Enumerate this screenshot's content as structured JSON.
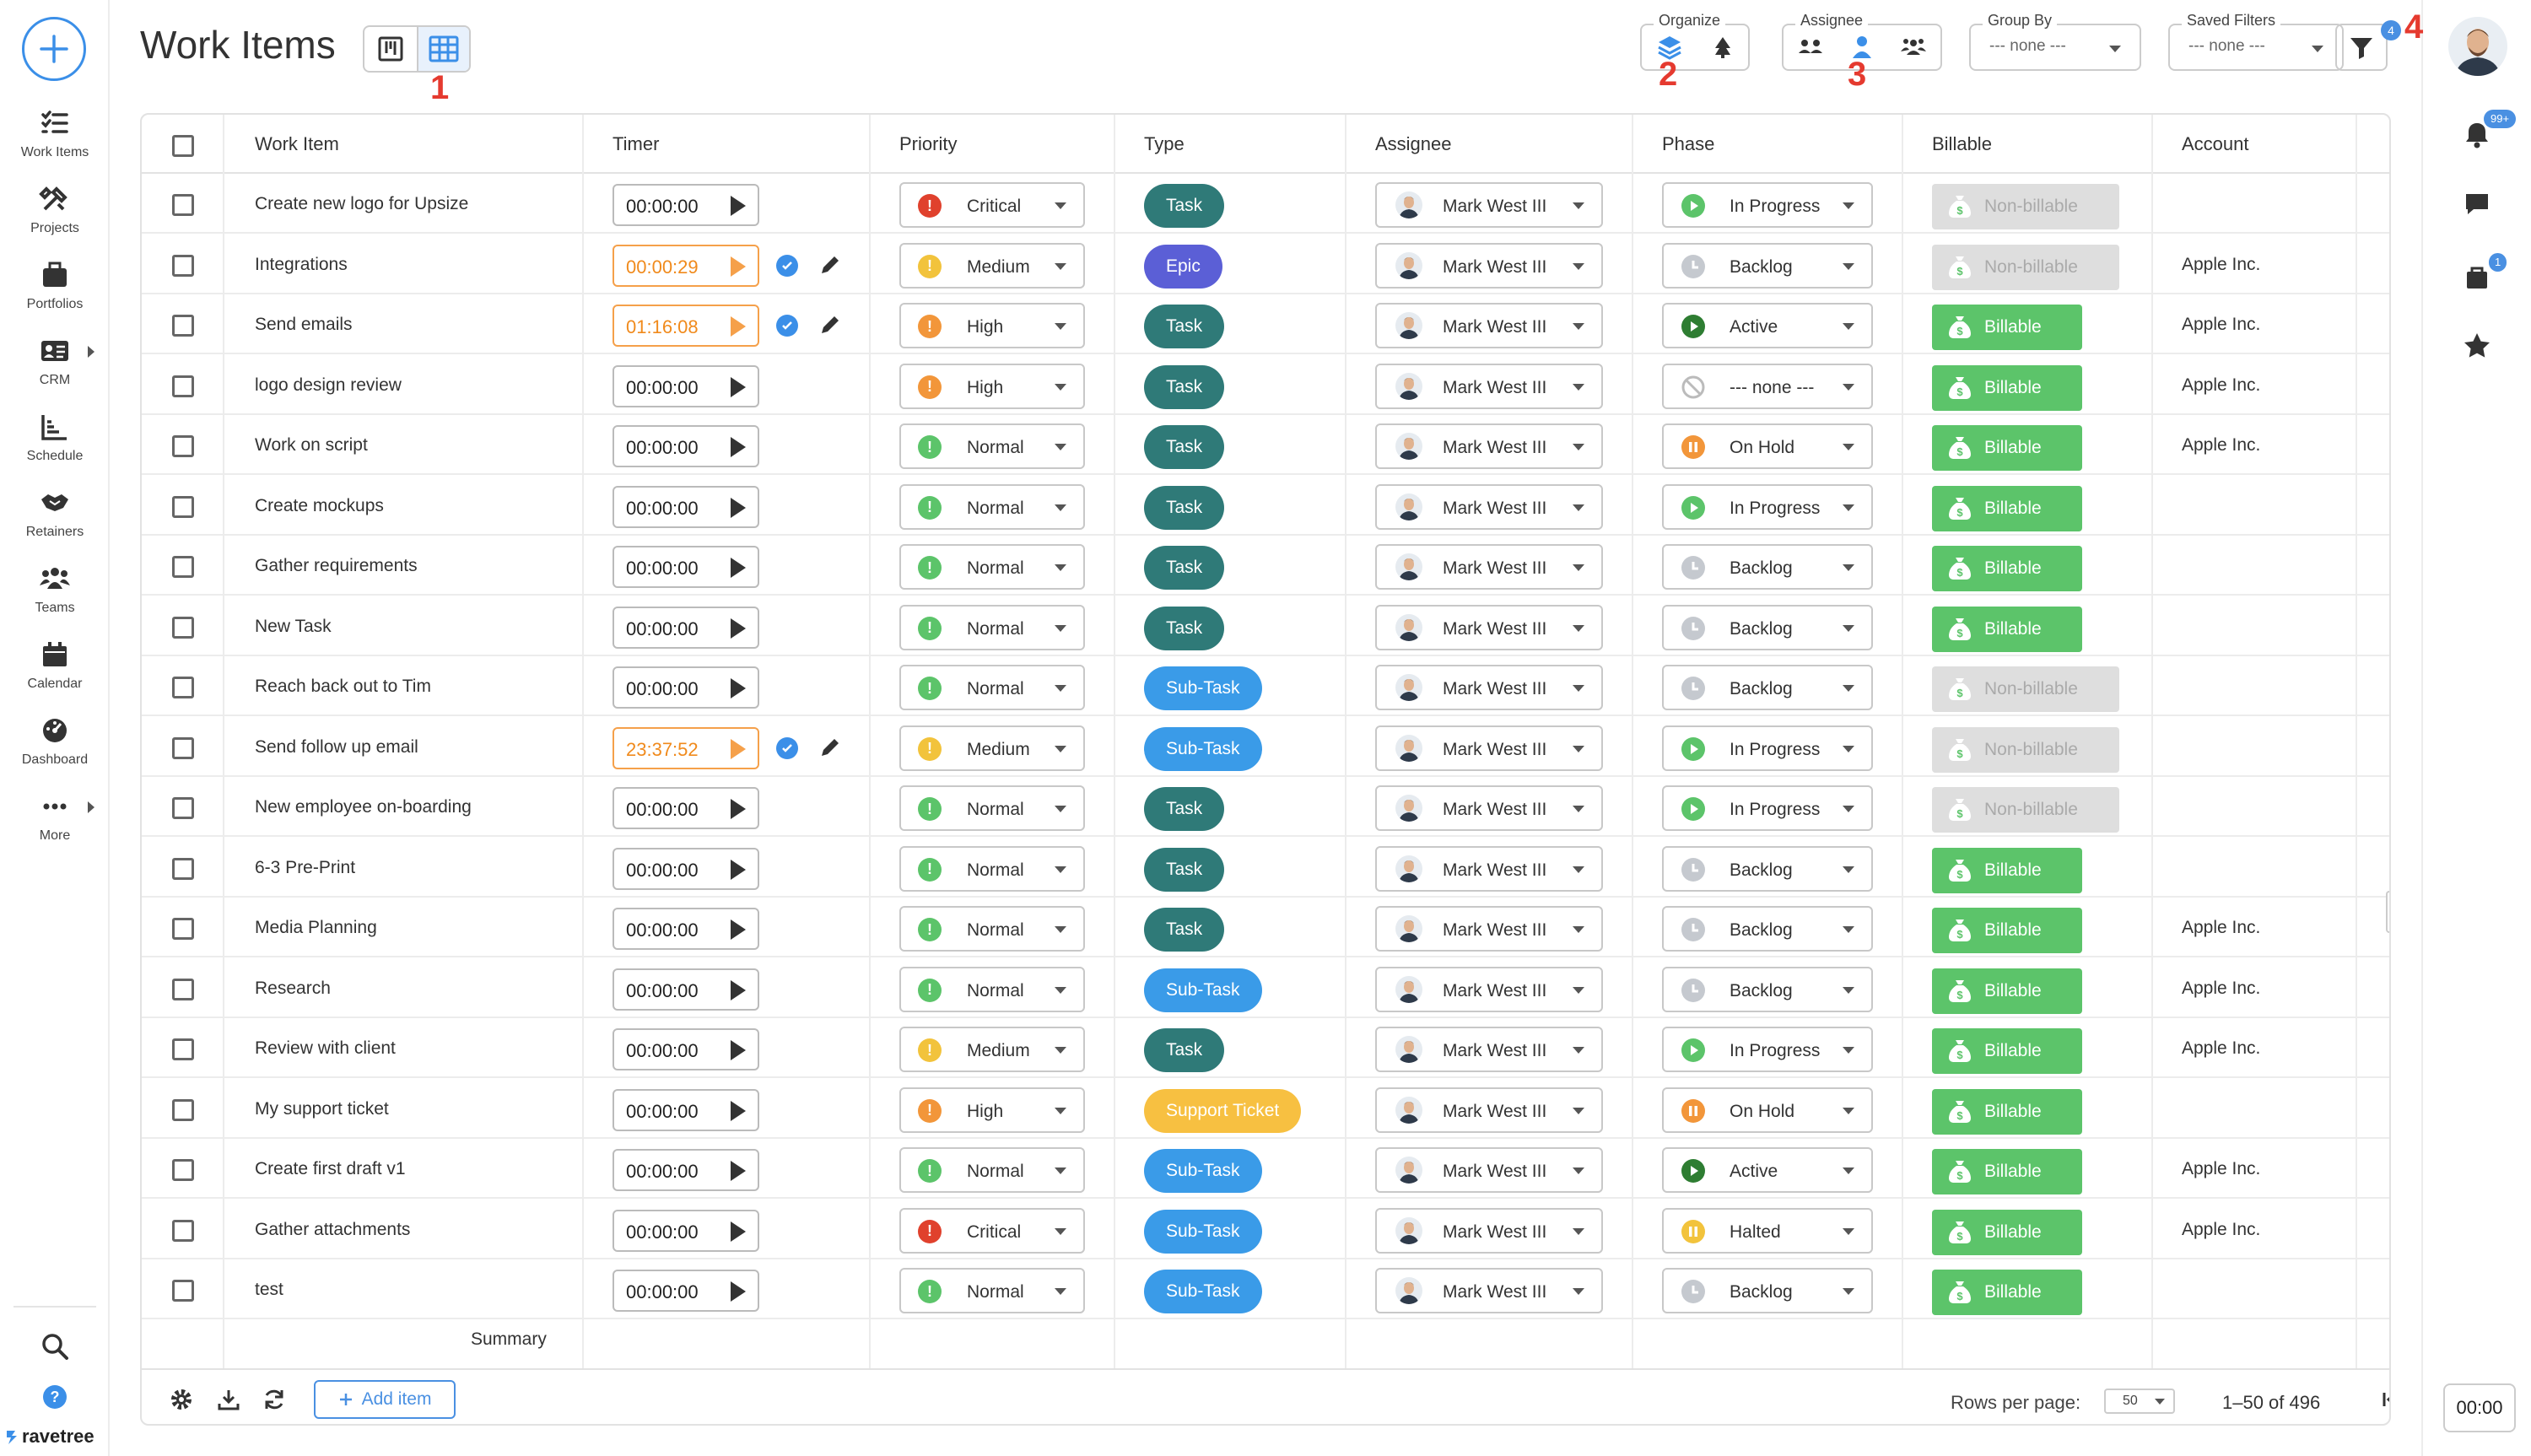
{
  "header": {
    "title": "Work Items",
    "organize_label": "Organize",
    "assignee_label": "Assignee",
    "group_by_label": "Group By",
    "group_by_value": "--- none ---",
    "saved_filters_label": "Saved Filters",
    "saved_filters_value": "--- none ---",
    "filter_badge": "4",
    "annotations": [
      "1",
      "2",
      "3",
      "4"
    ]
  },
  "nav": {
    "items": [
      {
        "label": "Work Items",
        "icon": "list-check-icon"
      },
      {
        "label": "Projects",
        "icon": "tools-icon"
      },
      {
        "label": "Portfolios",
        "icon": "briefcase-icon"
      },
      {
        "label": "CRM",
        "icon": "contact-card-icon"
      },
      {
        "label": "Schedule",
        "icon": "chart-line-icon"
      },
      {
        "label": "Retainers",
        "icon": "handshake-icon"
      },
      {
        "label": "Teams",
        "icon": "people-icon"
      },
      {
        "label": "Calendar",
        "icon": "calendar-icon"
      },
      {
        "label": "Dashboard",
        "icon": "gauge-icon"
      },
      {
        "label": "More",
        "icon": "dots-icon"
      }
    ],
    "brand": "ravetree"
  },
  "rail": {
    "notifications_badge": "99+",
    "calendar_badge": "1",
    "timer": "00:00"
  },
  "table": {
    "columns": [
      "Work Item",
      "Timer",
      "Priority",
      "Type",
      "Assignee",
      "Phase",
      "Billable",
      "Account"
    ],
    "rows": [
      {
        "name": "Create new logo for Upsize",
        "timer": "00:00:00",
        "running": false,
        "priority": "Critical",
        "type": "Task",
        "assignee": "Mark West III",
        "phase": "In Progress",
        "billable": "Non-billable",
        "account": ""
      },
      {
        "name": "Integrations",
        "timer": "00:00:29",
        "running": true,
        "priority": "Medium",
        "type": "Epic",
        "assignee": "Mark West III",
        "phase": "Backlog",
        "billable": "Non-billable",
        "account": "Apple Inc."
      },
      {
        "name": "Send emails",
        "timer": "01:16:08",
        "running": true,
        "priority": "High",
        "type": "Task",
        "assignee": "Mark West III",
        "phase": "Active",
        "billable": "Billable",
        "account": "Apple Inc."
      },
      {
        "name": "logo design review",
        "timer": "00:00:00",
        "running": false,
        "priority": "High",
        "type": "Task",
        "assignee": "Mark West III",
        "phase": "--- none ---",
        "billable": "Billable",
        "account": "Apple Inc."
      },
      {
        "name": "Work on script",
        "timer": "00:00:00",
        "running": false,
        "priority": "Normal",
        "type": "Task",
        "assignee": "Mark West III",
        "phase": "On Hold",
        "billable": "Billable",
        "account": "Apple Inc."
      },
      {
        "name": "Create mockups",
        "timer": "00:00:00",
        "running": false,
        "priority": "Normal",
        "type": "Task",
        "assignee": "Mark West III",
        "phase": "In Progress",
        "billable": "Billable",
        "account": ""
      },
      {
        "name": "Gather requirements",
        "timer": "00:00:00",
        "running": false,
        "priority": "Normal",
        "type": "Task",
        "assignee": "Mark West III",
        "phase": "Backlog",
        "billable": "Billable",
        "account": ""
      },
      {
        "name": "New Task",
        "timer": "00:00:00",
        "running": false,
        "priority": "Normal",
        "type": "Task",
        "assignee": "Mark West III",
        "phase": "Backlog",
        "billable": "Billable",
        "account": ""
      },
      {
        "name": "Reach back out to Tim",
        "timer": "00:00:00",
        "running": false,
        "priority": "Normal",
        "type": "Sub-Task",
        "assignee": "Mark West III",
        "phase": "Backlog",
        "billable": "Non-billable",
        "account": ""
      },
      {
        "name": "Send follow up email",
        "timer": "23:37:52",
        "running": true,
        "priority": "Medium",
        "type": "Sub-Task",
        "assignee": "Mark West III",
        "phase": "In Progress",
        "billable": "Non-billable",
        "account": ""
      },
      {
        "name": "New employee on-boarding",
        "timer": "00:00:00",
        "running": false,
        "priority": "Normal",
        "type": "Task",
        "assignee": "Mark West III",
        "phase": "In Progress",
        "billable": "Non-billable",
        "account": ""
      },
      {
        "name": "6-3 Pre-Print",
        "timer": "00:00:00",
        "running": false,
        "priority": "Normal",
        "type": "Task",
        "assignee": "Mark West III",
        "phase": "Backlog",
        "billable": "Billable",
        "account": ""
      },
      {
        "name": "Media Planning",
        "timer": "00:00:00",
        "running": false,
        "priority": "Normal",
        "type": "Task",
        "assignee": "Mark West III",
        "phase": "Backlog",
        "billable": "Billable",
        "account": "Apple Inc."
      },
      {
        "name": "Research",
        "timer": "00:00:00",
        "running": false,
        "priority": "Normal",
        "type": "Sub-Task",
        "assignee": "Mark West III",
        "phase": "Backlog",
        "billable": "Billable",
        "account": "Apple Inc."
      },
      {
        "name": "Review with client",
        "timer": "00:00:00",
        "running": false,
        "priority": "Medium",
        "type": "Task",
        "assignee": "Mark West III",
        "phase": "In Progress",
        "billable": "Billable",
        "account": "Apple Inc."
      },
      {
        "name": "My support ticket",
        "timer": "00:00:00",
        "running": false,
        "priority": "High",
        "type": "Support Ticket",
        "assignee": "Mark West III",
        "phase": "On Hold",
        "billable": "Billable",
        "account": ""
      },
      {
        "name": "Create first draft v1",
        "timer": "00:00:00",
        "running": false,
        "priority": "Normal",
        "type": "Sub-Task",
        "assignee": "Mark West III",
        "phase": "Active",
        "billable": "Billable",
        "account": "Apple Inc."
      },
      {
        "name": "Gather attachments",
        "timer": "00:00:00",
        "running": false,
        "priority": "Critical",
        "type": "Sub-Task",
        "assignee": "Mark West III",
        "phase": "Halted",
        "billable": "Billable",
        "account": "Apple Inc."
      },
      {
        "name": "test",
        "timer": "00:00:00",
        "running": false,
        "priority": "Normal",
        "type": "Sub-Task",
        "assignee": "Mark West III",
        "phase": "Backlog",
        "billable": "Billable",
        "account": ""
      }
    ],
    "summary_label": "Summary"
  },
  "footer": {
    "add_item": "Add item",
    "rows_per_page_label": "Rows per page:",
    "rows_per_page": "50",
    "range": "1–50 of 496"
  },
  "colors": {
    "accent": "#3b8fe8",
    "critical": "#e0412d",
    "medium": "#f2c33c",
    "high": "#f2963a",
    "normal": "#5cc46a",
    "task": "#2f7a78",
    "epic": "#5b5fd6",
    "subtask": "#3a9be8",
    "support": "#f7c041",
    "billable": "#5cc46a",
    "annotation": "#e53a2f"
  }
}
